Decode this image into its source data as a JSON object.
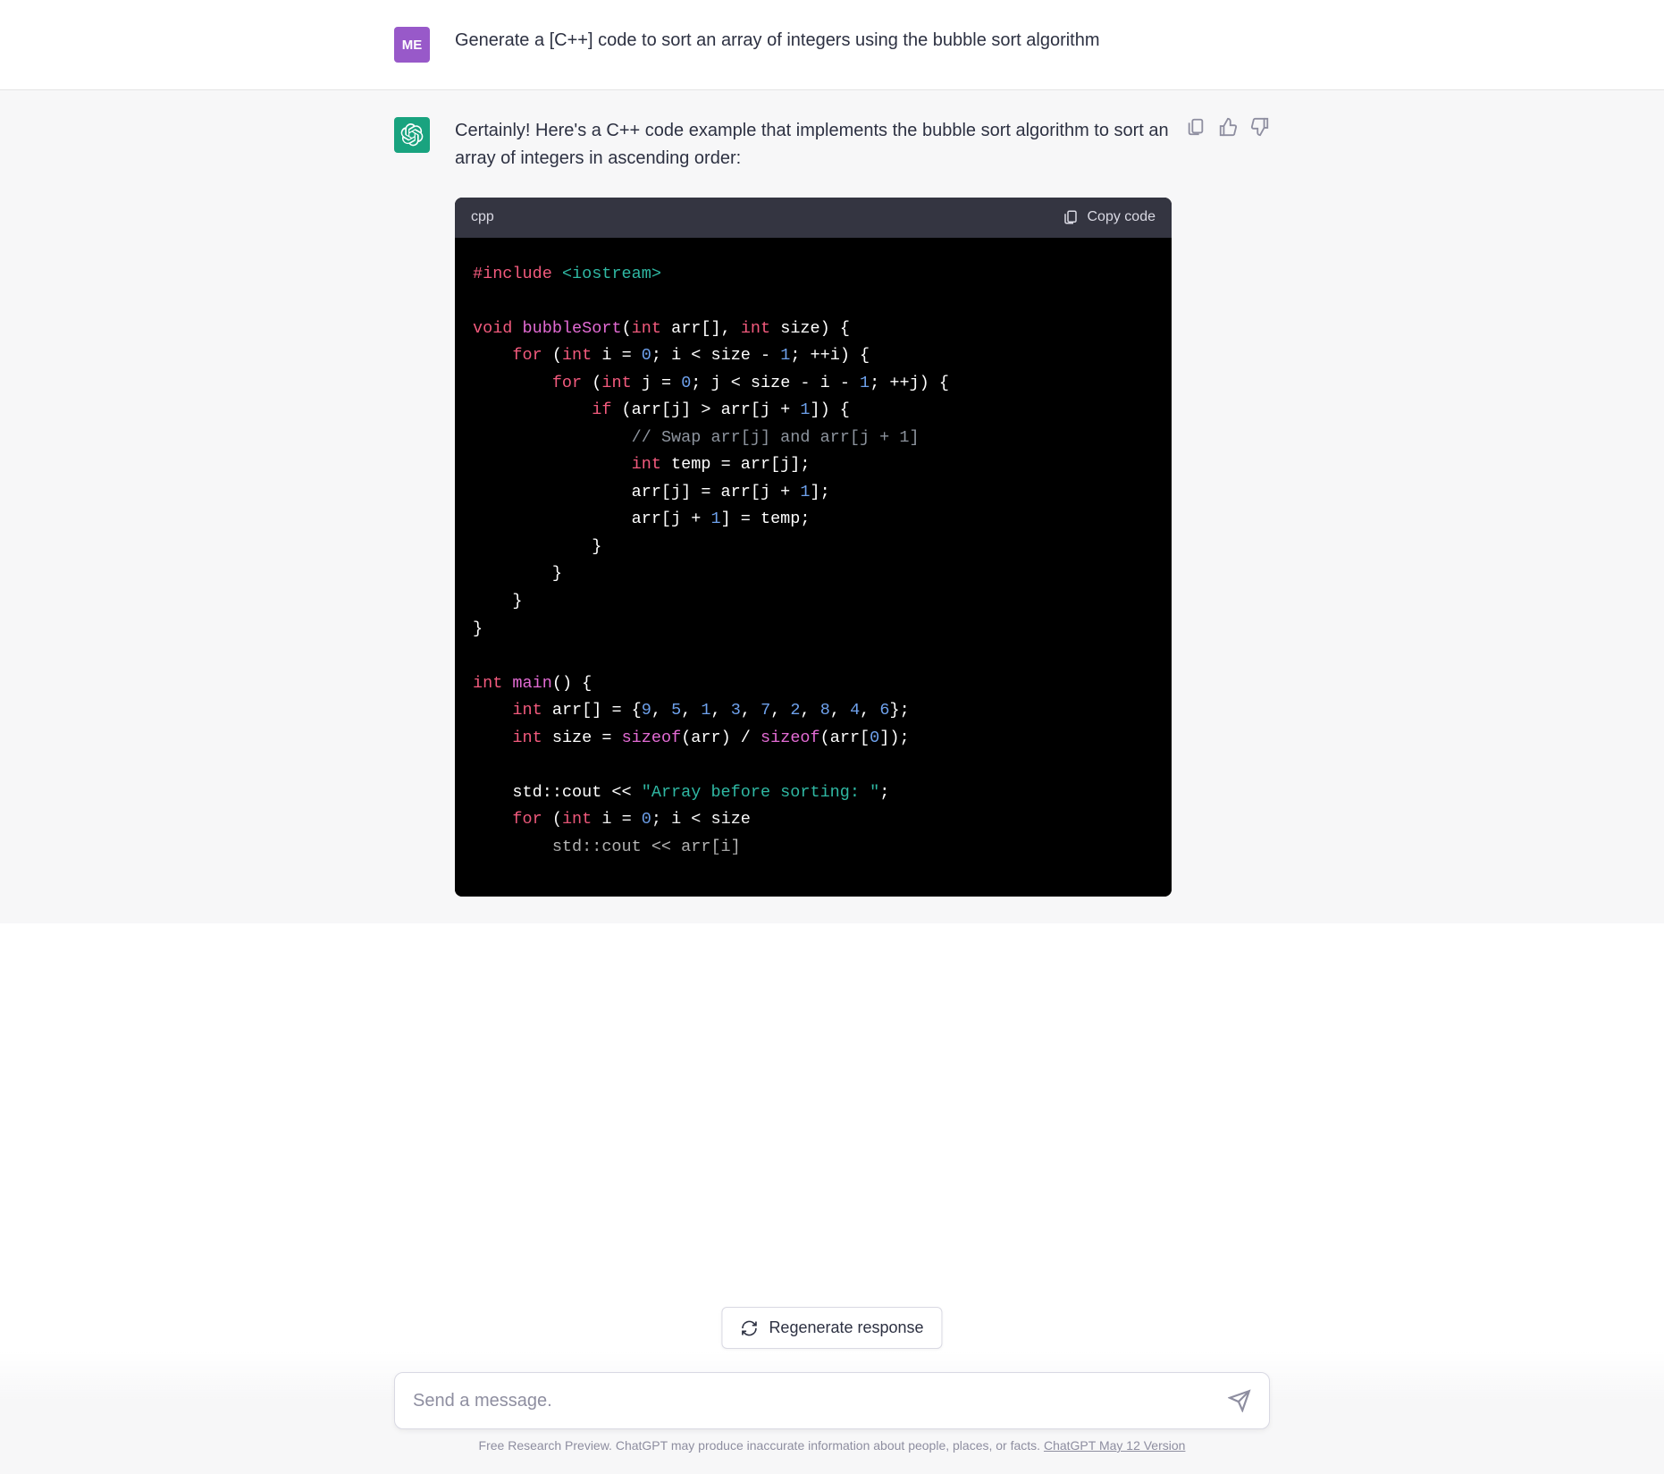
{
  "user_message": {
    "avatar_text": "ME",
    "text": "Generate a [C++] code to sort an array of integers using the bubble sort algorithm"
  },
  "assistant_message": {
    "intro_text": "Certainly! Here's a C++ code example that implements the bubble sort algorithm to sort an array of integers in ascending order:",
    "code_block": {
      "language_label": "cpp",
      "copy_label": "Copy code",
      "code_tokens": [
        [
          {
            "t": "pre",
            "v": "#include"
          },
          {
            "t": "op",
            "v": " "
          },
          {
            "t": "str",
            "v": "<iostream>"
          }
        ],
        [],
        [
          {
            "t": "pre",
            "v": "void"
          },
          {
            "t": "op",
            "v": " "
          },
          {
            "t": "fn",
            "v": "bubbleSort"
          },
          {
            "t": "op",
            "v": "("
          },
          {
            "t": "pre",
            "v": "int"
          },
          {
            "t": "op",
            "v": " arr[], "
          },
          {
            "t": "pre",
            "v": "int"
          },
          {
            "t": "op",
            "v": " size) {"
          }
        ],
        [
          {
            "t": "op",
            "v": "    "
          },
          {
            "t": "pre",
            "v": "for"
          },
          {
            "t": "op",
            "v": " ("
          },
          {
            "t": "pre",
            "v": "int"
          },
          {
            "t": "op",
            "v": " i = "
          },
          {
            "t": "num",
            "v": "0"
          },
          {
            "t": "op",
            "v": "; i < size - "
          },
          {
            "t": "num",
            "v": "1"
          },
          {
            "t": "op",
            "v": "; ++i) {"
          }
        ],
        [
          {
            "t": "op",
            "v": "        "
          },
          {
            "t": "pre",
            "v": "for"
          },
          {
            "t": "op",
            "v": " ("
          },
          {
            "t": "pre",
            "v": "int"
          },
          {
            "t": "op",
            "v": " j = "
          },
          {
            "t": "num",
            "v": "0"
          },
          {
            "t": "op",
            "v": "; j < size - i - "
          },
          {
            "t": "num",
            "v": "1"
          },
          {
            "t": "op",
            "v": "; ++j) {"
          }
        ],
        [
          {
            "t": "op",
            "v": "            "
          },
          {
            "t": "pre",
            "v": "if"
          },
          {
            "t": "op",
            "v": " (arr[j] > arr[j + "
          },
          {
            "t": "num",
            "v": "1"
          },
          {
            "t": "op",
            "v": "]) {"
          }
        ],
        [
          {
            "t": "op",
            "v": "                "
          },
          {
            "t": "com",
            "v": "// Swap arr[j] and arr[j + 1]"
          }
        ],
        [
          {
            "t": "op",
            "v": "                "
          },
          {
            "t": "pre",
            "v": "int"
          },
          {
            "t": "op",
            "v": " temp = arr[j];"
          }
        ],
        [
          {
            "t": "op",
            "v": "                arr[j] = arr[j + "
          },
          {
            "t": "num",
            "v": "1"
          },
          {
            "t": "op",
            "v": "];"
          }
        ],
        [
          {
            "t": "op",
            "v": "                arr[j + "
          },
          {
            "t": "num",
            "v": "1"
          },
          {
            "t": "op",
            "v": "] = temp;"
          }
        ],
        [
          {
            "t": "op",
            "v": "            }"
          }
        ],
        [
          {
            "t": "op",
            "v": "        }"
          }
        ],
        [
          {
            "t": "op",
            "v": "    }"
          }
        ],
        [
          {
            "t": "op",
            "v": "}"
          }
        ],
        [],
        [
          {
            "t": "pre",
            "v": "int"
          },
          {
            "t": "op",
            "v": " "
          },
          {
            "t": "fn",
            "v": "main"
          },
          {
            "t": "op",
            "v": "() {"
          }
        ],
        [
          {
            "t": "op",
            "v": "    "
          },
          {
            "t": "pre",
            "v": "int"
          },
          {
            "t": "op",
            "v": " arr[] = {"
          },
          {
            "t": "num",
            "v": "9"
          },
          {
            "t": "op",
            "v": ", "
          },
          {
            "t": "num",
            "v": "5"
          },
          {
            "t": "op",
            "v": ", "
          },
          {
            "t": "num",
            "v": "1"
          },
          {
            "t": "op",
            "v": ", "
          },
          {
            "t": "num",
            "v": "3"
          },
          {
            "t": "op",
            "v": ", "
          },
          {
            "t": "num",
            "v": "7"
          },
          {
            "t": "op",
            "v": ", "
          },
          {
            "t": "num",
            "v": "2"
          },
          {
            "t": "op",
            "v": ", "
          },
          {
            "t": "num",
            "v": "8"
          },
          {
            "t": "op",
            "v": ", "
          },
          {
            "t": "num",
            "v": "4"
          },
          {
            "t": "op",
            "v": ", "
          },
          {
            "t": "num",
            "v": "6"
          },
          {
            "t": "op",
            "v": "};"
          }
        ],
        [
          {
            "t": "op",
            "v": "    "
          },
          {
            "t": "pre",
            "v": "int"
          },
          {
            "t": "op",
            "v": " size = "
          },
          {
            "t": "fn",
            "v": "sizeof"
          },
          {
            "t": "op",
            "v": "(arr) / "
          },
          {
            "t": "fn",
            "v": "sizeof"
          },
          {
            "t": "op",
            "v": "(arr["
          },
          {
            "t": "num",
            "v": "0"
          },
          {
            "t": "op",
            "v": "]);"
          }
        ],
        [],
        [
          {
            "t": "op",
            "v": "    std::cout << "
          },
          {
            "t": "str",
            "v": "\"Array before sorting: \""
          },
          {
            "t": "op",
            "v": ";"
          }
        ],
        [
          {
            "t": "op",
            "v": "    "
          },
          {
            "t": "pre",
            "v": "for"
          },
          {
            "t": "op",
            "v": " ("
          },
          {
            "t": "pre",
            "v": "int"
          },
          {
            "t": "op",
            "v": " i = "
          },
          {
            "t": "num",
            "v": "0"
          },
          {
            "t": "op",
            "v": "; i < size"
          }
        ],
        [
          {
            "t": "op",
            "v": "        std::cout << arr[i]"
          }
        ]
      ]
    }
  },
  "actions": {
    "regenerate_label": "Regenerate response"
  },
  "composer": {
    "placeholder": "Send a message."
  },
  "footer": {
    "prefix": "Free Research Preview. ChatGPT may produce inaccurate information about people, places, or facts. ",
    "link": "ChatGPT May 12 Version"
  }
}
